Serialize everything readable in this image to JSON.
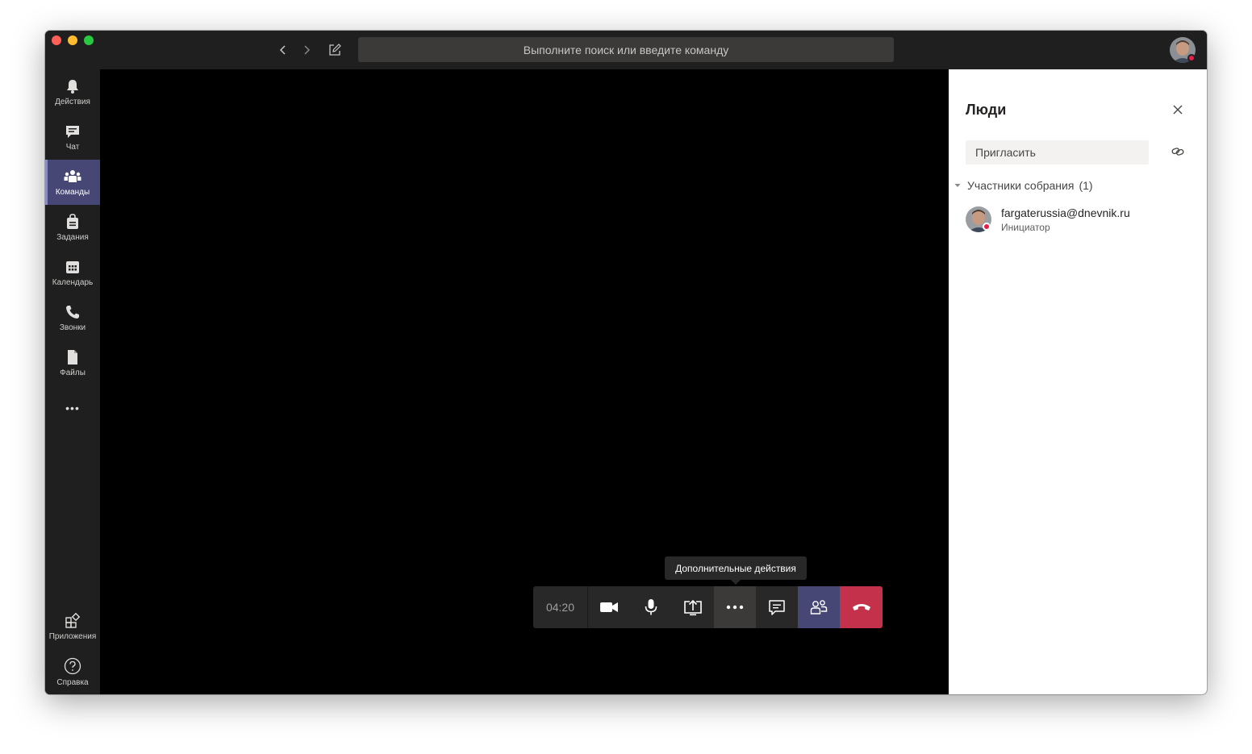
{
  "titlebar": {
    "search_placeholder": "Выполните поиск или введите команду"
  },
  "rail": {
    "items": [
      {
        "label": "Действия",
        "icon": "bell-icon"
      },
      {
        "label": "Чат",
        "icon": "chat-icon"
      },
      {
        "label": "Команды",
        "icon": "teams-icon",
        "active": true
      },
      {
        "label": "Задания",
        "icon": "assignments-icon"
      },
      {
        "label": "Календарь",
        "icon": "calendar-icon"
      },
      {
        "label": "Звонки",
        "icon": "phone-icon"
      },
      {
        "label": "Файлы",
        "icon": "file-icon"
      }
    ],
    "more": "•••",
    "apps_label": "Приложения",
    "help_label": "Справка"
  },
  "call": {
    "timer": "04:20",
    "tooltip": "Дополнительные действия",
    "accent": "#464775",
    "hangup_color": "#c4314b"
  },
  "panel": {
    "title": "Люди",
    "invite_placeholder": "Пригласить",
    "section_label": "Участники собрания",
    "section_count": "(1)",
    "participants": [
      {
        "name": "fargaterussia@dnevnik.ru",
        "role": "Инициатор"
      }
    ]
  }
}
